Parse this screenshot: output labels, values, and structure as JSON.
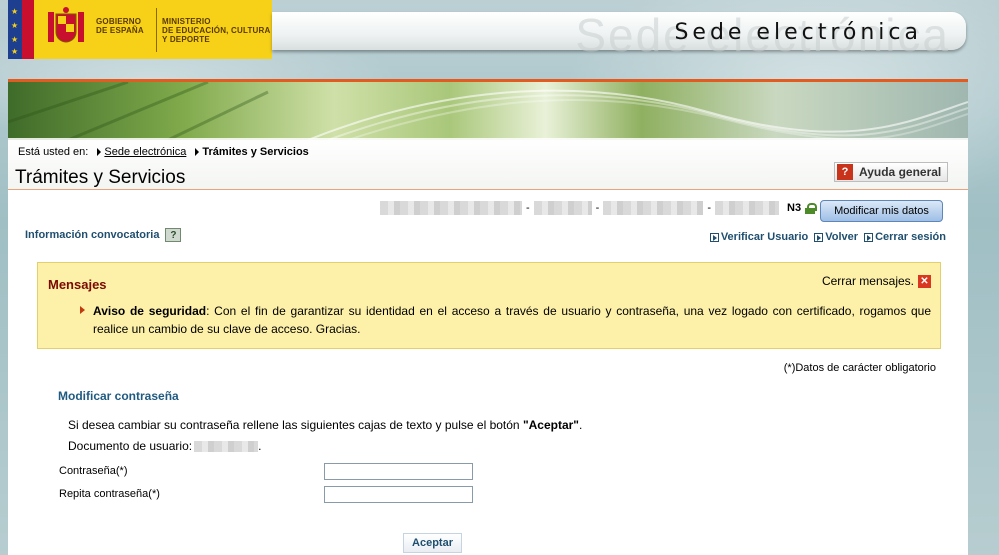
{
  "header": {
    "gov_line1": "GOBIERNO",
    "gov_line2": "DE ESPAÑA",
    "ministry_line1": "MINISTERIO",
    "ministry_line2": "DE EDUCACIÓN, CULTURA",
    "ministry_line3": "Y DEPORTE",
    "site_title": "Sede electrónica",
    "site_title_ghost": "Sede electrónica"
  },
  "breadcrumb": {
    "prefix": "Está usted en:",
    "items": [
      "Sede electrónica",
      "Trámites y Servicios"
    ]
  },
  "page_title": "Trámites y Servicios",
  "help_button": {
    "icon": "?",
    "label": "Ayuda general"
  },
  "user": {
    "level": "N3",
    "modify_button": "Modificar mis datos"
  },
  "info_convocatoria": {
    "label": "Información convocatoria",
    "icon": "?"
  },
  "links": [
    "Verificar Usuario",
    "Volver",
    "Cerrar sesión"
  ],
  "messages": {
    "title": "Mensajes",
    "close_label": "Cerrar mensajes.",
    "close_icon": "✕",
    "items": [
      {
        "strong": "Aviso de seguridad",
        "text": ": Con el fin de garantizar su identidad en el acceso a través de usuario y contraseña, una vez logado con certificado, rogamos que realice un cambio de su clave de acceso. Gracias."
      }
    ]
  },
  "form": {
    "required_note": "(*)Datos de carácter obligatorio",
    "title": "Modificar contraseña",
    "description_pre": "Si desea cambiar su contraseña rellene las siguientes cajas de texto y pulse el botón ",
    "description_strong": "\"Aceptar\"",
    "description_post": ".",
    "doc_label": "Documento de usuario:",
    "doc_suffix": ".",
    "password_label": "Contraseña(*)",
    "password_value": "",
    "repeat_label": "Repita contraseña(*)",
    "repeat_value": "",
    "submit_label": "Aceptar"
  },
  "colors": {
    "accent_orange": "#e25b20",
    "link_blue": "#1f4e6e",
    "messages_bg": "#fdf0a8",
    "title_red": "#7a0a00"
  }
}
